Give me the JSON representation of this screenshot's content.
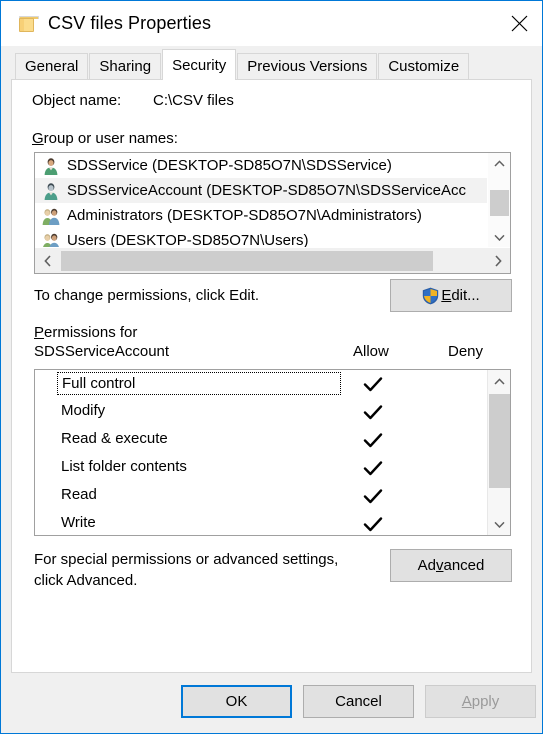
{
  "window": {
    "title": "CSV files Properties",
    "folder_icon": "folder-icon",
    "close_icon": "close-icon",
    "border_color": "#0078d7"
  },
  "tabs": [
    {
      "label": "General",
      "active": false
    },
    {
      "label": "Sharing",
      "active": false
    },
    {
      "label": "Security",
      "active": true
    },
    {
      "label": "Previous Versions",
      "active": false
    },
    {
      "label": "Customize",
      "active": false
    }
  ],
  "security": {
    "object_name_label": "Object name:",
    "object_name_value": "C:\\CSV files",
    "group_label_first": "G",
    "group_label_rest": "roup or user names:",
    "group_list": [
      {
        "name": "SDSService (DESKTOP-SD85O7N\\SDSService)",
        "icon": "user-icon",
        "selected": false
      },
      {
        "name": "SDSServiceAccount (DESKTOP-SD85O7N\\SDSServiceAcc",
        "icon": "user-icon",
        "selected": true
      },
      {
        "name": "Administrators (DESKTOP-SD85O7N\\Administrators)",
        "icon": "group-icon",
        "selected": false
      },
      {
        "name": "Users (DESKTOP-SD85O7N\\Users)",
        "icon": "group-icon",
        "selected": false
      }
    ],
    "change_permissions_text": "To change permissions, click Edit.",
    "edit_button_first": "E",
    "edit_button_rest": "dit...",
    "edit_shield_icon": "uac-shield-icon",
    "permissions_label_first": "P",
    "permissions_label_rest": "ermissions for",
    "permissions_subject": "SDSServiceAccount",
    "column_allow": "Allow",
    "column_deny": "Deny",
    "permissions": [
      {
        "name": "Full control",
        "allow": true,
        "deny": false,
        "focused": true
      },
      {
        "name": "Modify",
        "allow": true,
        "deny": false,
        "focused": false
      },
      {
        "name": "Read & execute",
        "allow": true,
        "deny": false,
        "focused": false
      },
      {
        "name": "List folder contents",
        "allow": true,
        "deny": false,
        "focused": false
      },
      {
        "name": "Read",
        "allow": true,
        "deny": false,
        "focused": false
      },
      {
        "name": "Write",
        "allow": true,
        "deny": false,
        "focused": false
      }
    ],
    "advanced_text_line1": "For special permissions or advanced settings,",
    "advanced_text_line2": "click Advanced.",
    "advanced_button_pre": "Ad",
    "advanced_button_mnemonic": "v",
    "advanced_button_post": "anced"
  },
  "footer": {
    "ok": "OK",
    "cancel": "Cancel",
    "apply_first": "A",
    "apply_rest": "pply",
    "apply_disabled": true
  }
}
